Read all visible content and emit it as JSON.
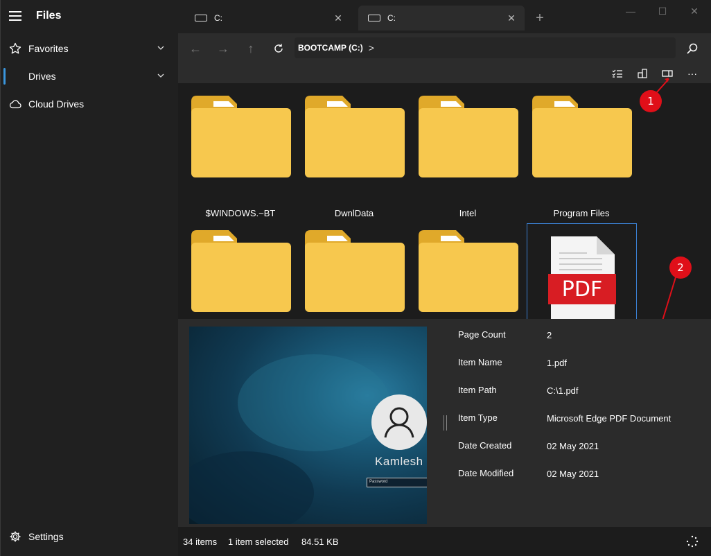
{
  "app": {
    "title": "Files"
  },
  "sidebar": {
    "items": [
      {
        "label": "Favorites",
        "icon": "star-icon"
      },
      {
        "label": "Drives",
        "icon": "drive-icon"
      },
      {
        "label": "Cloud Drives",
        "icon": "cloud-icon"
      }
    ],
    "settings_label": "Settings",
    "accent": "#3a96dd"
  },
  "tabs": [
    {
      "label": "C:",
      "active": false
    },
    {
      "label": "C:",
      "active": true
    }
  ],
  "address": {
    "crumb": "BOOTCAMP (C:)",
    "separator": ">"
  },
  "items": [
    {
      "name": "$WINDOWS.~BT",
      "type": "folder"
    },
    {
      "name": "DwnlData",
      "type": "folder"
    },
    {
      "name": "Intel",
      "type": "folder"
    },
    {
      "name": "Program Files",
      "type": "folder"
    },
    {
      "name": "",
      "type": "folder"
    },
    {
      "name": "",
      "type": "folder"
    },
    {
      "name": "",
      "type": "folder"
    },
    {
      "name": "",
      "type": "pdf",
      "badge": "PDF",
      "selected": true
    }
  ],
  "callouts": [
    "1",
    "2"
  ],
  "preview": {
    "user_name": "Kamlesh",
    "password_placeholder": "Password",
    "properties": [
      {
        "label": "Page Count",
        "value": "2"
      },
      {
        "label": "Item Name",
        "value": "1.pdf"
      },
      {
        "label": "Item Path",
        "value": "C:\\1.pdf"
      },
      {
        "label": "Item Type",
        "value": "Microsoft Edge PDF Document"
      },
      {
        "label": "Date Created",
        "value": "02 May 2021"
      },
      {
        "label": "Date Modified",
        "value": "02 May 2021"
      }
    ]
  },
  "status": {
    "item_count": "34 items",
    "selected": "1 item selected",
    "size": "84.51 KB"
  },
  "colors": {
    "folder": "#f7c84e",
    "folder_back": "#e0a92a",
    "pdf_red": "#d81d23",
    "selection": "#3a7fd0",
    "callout": "#e00f19"
  }
}
